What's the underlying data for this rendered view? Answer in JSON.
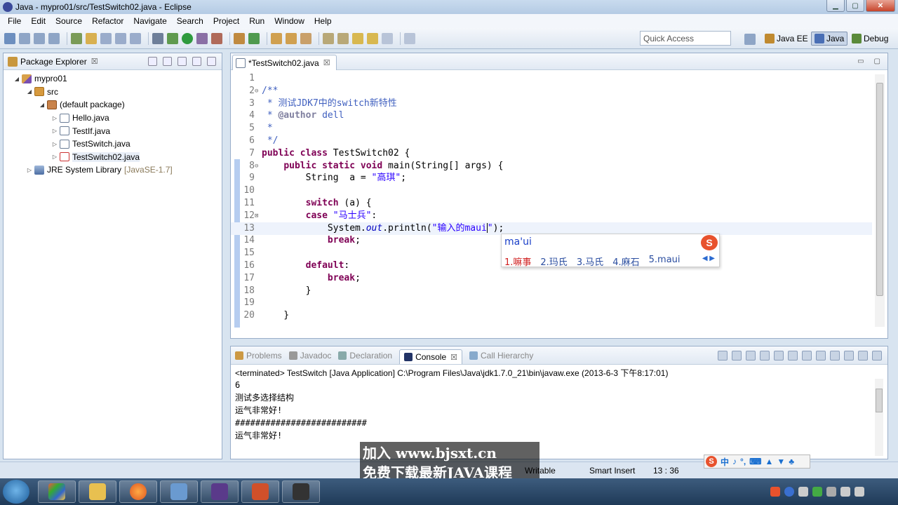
{
  "window": {
    "title": "Java - mypro01/src/TestSwitch02.java - Eclipse",
    "minimize": "▁",
    "maximize": "▢",
    "close": "✕"
  },
  "menu": [
    "File",
    "Edit",
    "Source",
    "Refactor",
    "Navigate",
    "Search",
    "Project",
    "Run",
    "Window",
    "Help"
  ],
  "toolbar": {
    "quick_access": "Quick Access",
    "perspectives": [
      {
        "label": "Java EE",
        "color": "#c08a30"
      },
      {
        "label": "Java",
        "color": "#4a6fb5"
      },
      {
        "label": "Debug",
        "color": "#5a8a3a"
      }
    ]
  },
  "package_explorer": {
    "title": "Package Explorer",
    "close": "☒",
    "tree": [
      {
        "label": "mypro01",
        "arrow": "◢",
        "icon": "project-icon",
        "depth": 0
      },
      {
        "label": "src",
        "arrow": "◢",
        "icon": "source-folder-icon",
        "depth": 1
      },
      {
        "label": "(default package)",
        "arrow": "◢",
        "icon": "package-icon",
        "depth": 2
      },
      {
        "label": "Hello.java",
        "arrow": "▷",
        "icon": "java-file-icon",
        "depth": 3
      },
      {
        "label": "TestIf.java",
        "arrow": "▷",
        "icon": "java-file-icon",
        "depth": 3
      },
      {
        "label": "TestSwitch.java",
        "arrow": "▷",
        "icon": "java-file-icon",
        "depth": 3
      },
      {
        "label": "TestSwitch02.java",
        "arrow": "▷",
        "icon": "java-file-error-icon",
        "depth": 3
      },
      {
        "label": "JRE System Library",
        "arrow": "▷",
        "icon": "library-icon",
        "depth": 0,
        "extra": "[JavaSE-1.7]"
      }
    ]
  },
  "editor": {
    "tab": "*TestSwitch02.java",
    "tab_close": "☒",
    "lines": [
      {
        "n": "1",
        "fold": "",
        "html": []
      },
      {
        "n": "2",
        "fold": "⊖",
        "html": [
          [
            "cm",
            "/**"
          ]
        ]
      },
      {
        "n": "3",
        "fold": "",
        "html": [
          [
            "cm",
            " * 测试JDK7中的switch新特性"
          ]
        ]
      },
      {
        "n": "4",
        "fold": "",
        "html": [
          [
            "cm",
            " * "
          ],
          [
            "cm-tag",
            "@author"
          ],
          [
            "cm",
            " dell"
          ]
        ]
      },
      {
        "n": "5",
        "fold": "",
        "html": [
          [
            "cm",
            " *"
          ]
        ]
      },
      {
        "n": "6",
        "fold": "",
        "html": [
          [
            "cm",
            " */"
          ]
        ]
      },
      {
        "n": "7",
        "fold": "",
        "html": [
          [
            "kw",
            "public"
          ],
          [
            "",
            " "
          ],
          [
            "kw",
            "class"
          ],
          [
            "",
            " TestSwitch02 {"
          ]
        ]
      },
      {
        "n": "8",
        "fold": "⊖",
        "html": [
          [
            "",
            "    "
          ],
          [
            "kw",
            "public"
          ],
          [
            "",
            " "
          ],
          [
            "kw",
            "static"
          ],
          [
            "",
            " "
          ],
          [
            "kw",
            "void"
          ],
          [
            "",
            " main(String[] args) {"
          ]
        ]
      },
      {
        "n": "9",
        "fold": "",
        "html": [
          [
            "",
            "        String  a = "
          ],
          [
            "str",
            "\"高琪\""
          ],
          [
            "",
            ";"
          ]
        ]
      },
      {
        "n": "10",
        "fold": "",
        "html": []
      },
      {
        "n": "11",
        "fold": "",
        "html": [
          [
            "",
            "        "
          ],
          [
            "kw",
            "switch"
          ],
          [
            "",
            " (a) {"
          ]
        ]
      },
      {
        "n": "12",
        "fold": "⊠",
        "html": [
          [
            "",
            "        "
          ],
          [
            "kw",
            "case"
          ],
          [
            "",
            " "
          ],
          [
            "str",
            "\"马士兵\""
          ],
          [
            "",
            ":"
          ]
        ]
      },
      {
        "n": "13",
        "fold": "",
        "current": true,
        "html": [
          [
            "",
            "            System."
          ],
          [
            "fld",
            "out"
          ],
          [
            "",
            ".println("
          ],
          [
            "str",
            "\"输入的maui"
          ],
          [
            "cursor",
            ""
          ],
          [
            "str",
            "\""
          ],
          [
            "",
            ");"
          ]
        ]
      },
      {
        "n": "14",
        "fold": "",
        "html": [
          [
            "",
            "            "
          ],
          [
            "kw",
            "break"
          ],
          [
            "",
            ";"
          ]
        ]
      },
      {
        "n": "15",
        "fold": "",
        "html": []
      },
      {
        "n": "16",
        "fold": "",
        "html": [
          [
            "",
            "        "
          ],
          [
            "kw",
            "default"
          ],
          [
            "",
            ":"
          ]
        ]
      },
      {
        "n": "17",
        "fold": "",
        "html": [
          [
            "",
            "            "
          ],
          [
            "kw",
            "break"
          ],
          [
            "",
            ";"
          ]
        ]
      },
      {
        "n": "18",
        "fold": "",
        "html": [
          [
            "",
            "        }"
          ]
        ]
      },
      {
        "n": "19",
        "fold": "",
        "html": []
      },
      {
        "n": "20",
        "fold": "",
        "html": [
          [
            "",
            "    }"
          ]
        ]
      }
    ]
  },
  "ime_popup": {
    "input": "ma'ui",
    "logo": "S",
    "candidates": [
      "1.嘛事",
      "2.玛氏",
      "3.马氏",
      "4.麻石",
      "5.maui"
    ],
    "nav": "◀ ▶"
  },
  "bottom_panel": {
    "tabs": [
      {
        "label": "Problems",
        "active": false,
        "color": "#c94"
      },
      {
        "label": "Javadoc",
        "active": false,
        "color": "#999"
      },
      {
        "label": "Declaration",
        "active": false,
        "color": "#8aa"
      },
      {
        "label": "Console",
        "active": true,
        "color": "#236"
      },
      {
        "label": "Call Hierarchy",
        "active": false,
        "color": "#8ac"
      }
    ],
    "console_close": "☒",
    "terminated": "<terminated> TestSwitch [Java Application] C:\\Program Files\\Java\\jdk1.7.0_21\\bin\\javaw.exe (2013-6-3 下午8:17:01)",
    "output": [
      "6",
      "测试多选择结构",
      "运气非常好!",
      "##########################",
      "运气非常好!"
    ]
  },
  "status": {
    "writable": "Writable",
    "insert_mode": "Smart Insert",
    "position": "13 : 36"
  },
  "ime_bar": [
    "S",
    "中",
    "♪",
    "°,",
    "⌨",
    "▲",
    "▼",
    "♣"
  ],
  "watermark": {
    "line1": "加入 www.bjsxt.cn",
    "line2": "免费下载最新JAVA课程"
  }
}
